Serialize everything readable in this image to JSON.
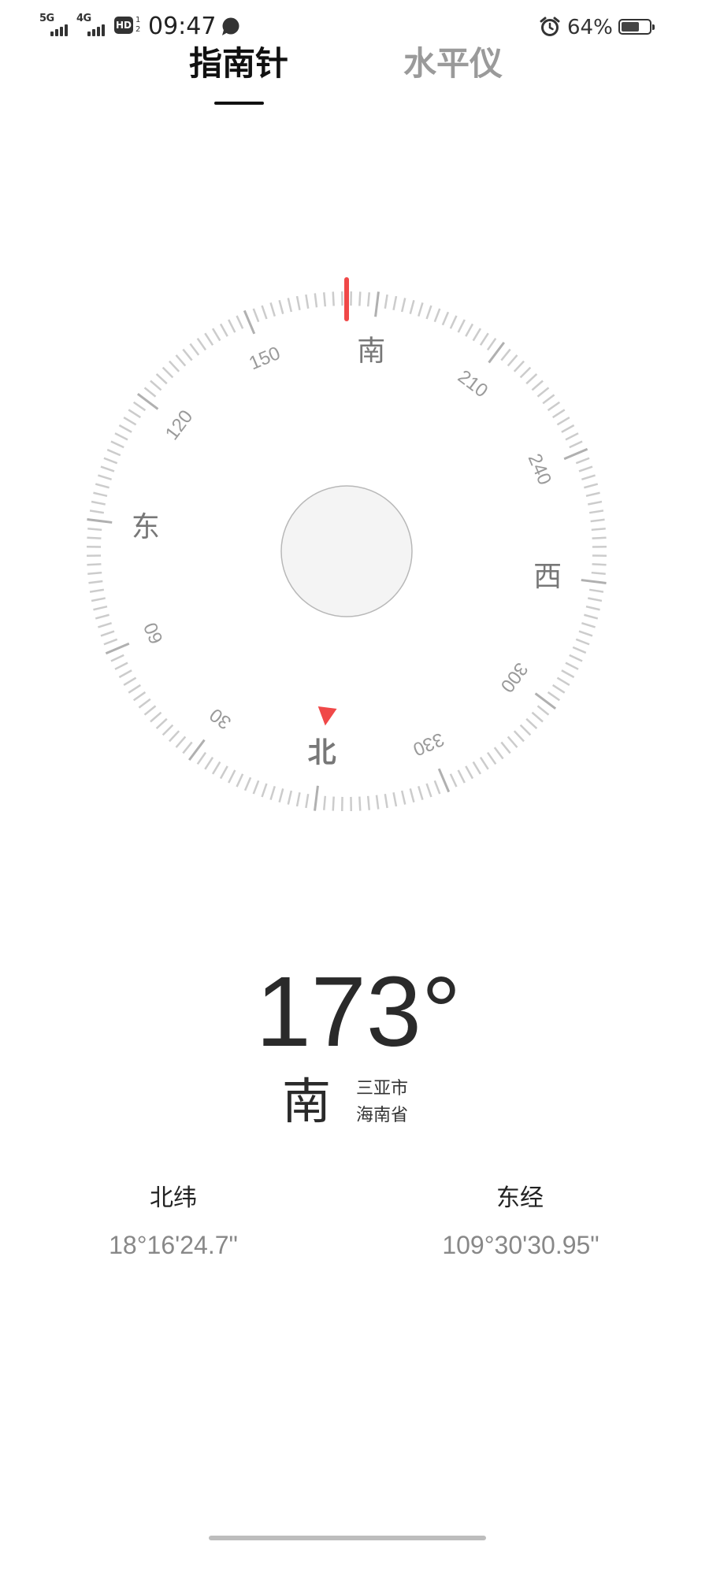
{
  "status_bar": {
    "network_1": "5G",
    "network_2": "4G",
    "hd": "HD",
    "hd_sub_top": "1",
    "hd_sub_bottom": "2",
    "time": "09:47",
    "battery_text": "64%",
    "battery_level": 0.64,
    "icons": {
      "signal_1": "signal-icon",
      "signal_2": "signal-icon",
      "hd": "hd-voice-icon",
      "message": "message-icon",
      "alarm": "alarm-icon",
      "battery": "battery-icon"
    }
  },
  "tabs": [
    {
      "label": "指南针",
      "active": true
    },
    {
      "label": "水平仪",
      "active": false
    }
  ],
  "compass": {
    "heading_deg": 173,
    "accent": "#f04848",
    "cardinals": [
      {
        "text": "北",
        "bearing": 0,
        "color": "#f04848"
      },
      {
        "text": "东",
        "bearing": 90,
        "color": "#777777"
      },
      {
        "text": "南",
        "bearing": 180,
        "color": "#777777"
      },
      {
        "text": "西",
        "bearing": 270,
        "color": "#777777"
      }
    ],
    "degree_labels": [
      {
        "text": "30",
        "bearing": 30
      },
      {
        "text": "60",
        "bearing": 60
      },
      {
        "text": "120",
        "bearing": 120
      },
      {
        "text": "150",
        "bearing": 150
      },
      {
        "text": "210",
        "bearing": 210
      },
      {
        "text": "240",
        "bearing": 240
      },
      {
        "text": "300",
        "bearing": 300
      },
      {
        "text": "330",
        "bearing": 330
      }
    ]
  },
  "reading": {
    "heading": "173°",
    "direction": "南",
    "city": "三亚市",
    "province": "海南省"
  },
  "coordinates": {
    "latitude_label": "北纬",
    "latitude": "18°16'24.7\"",
    "longitude_label": "东经",
    "longitude": "109°30'30.95\""
  }
}
